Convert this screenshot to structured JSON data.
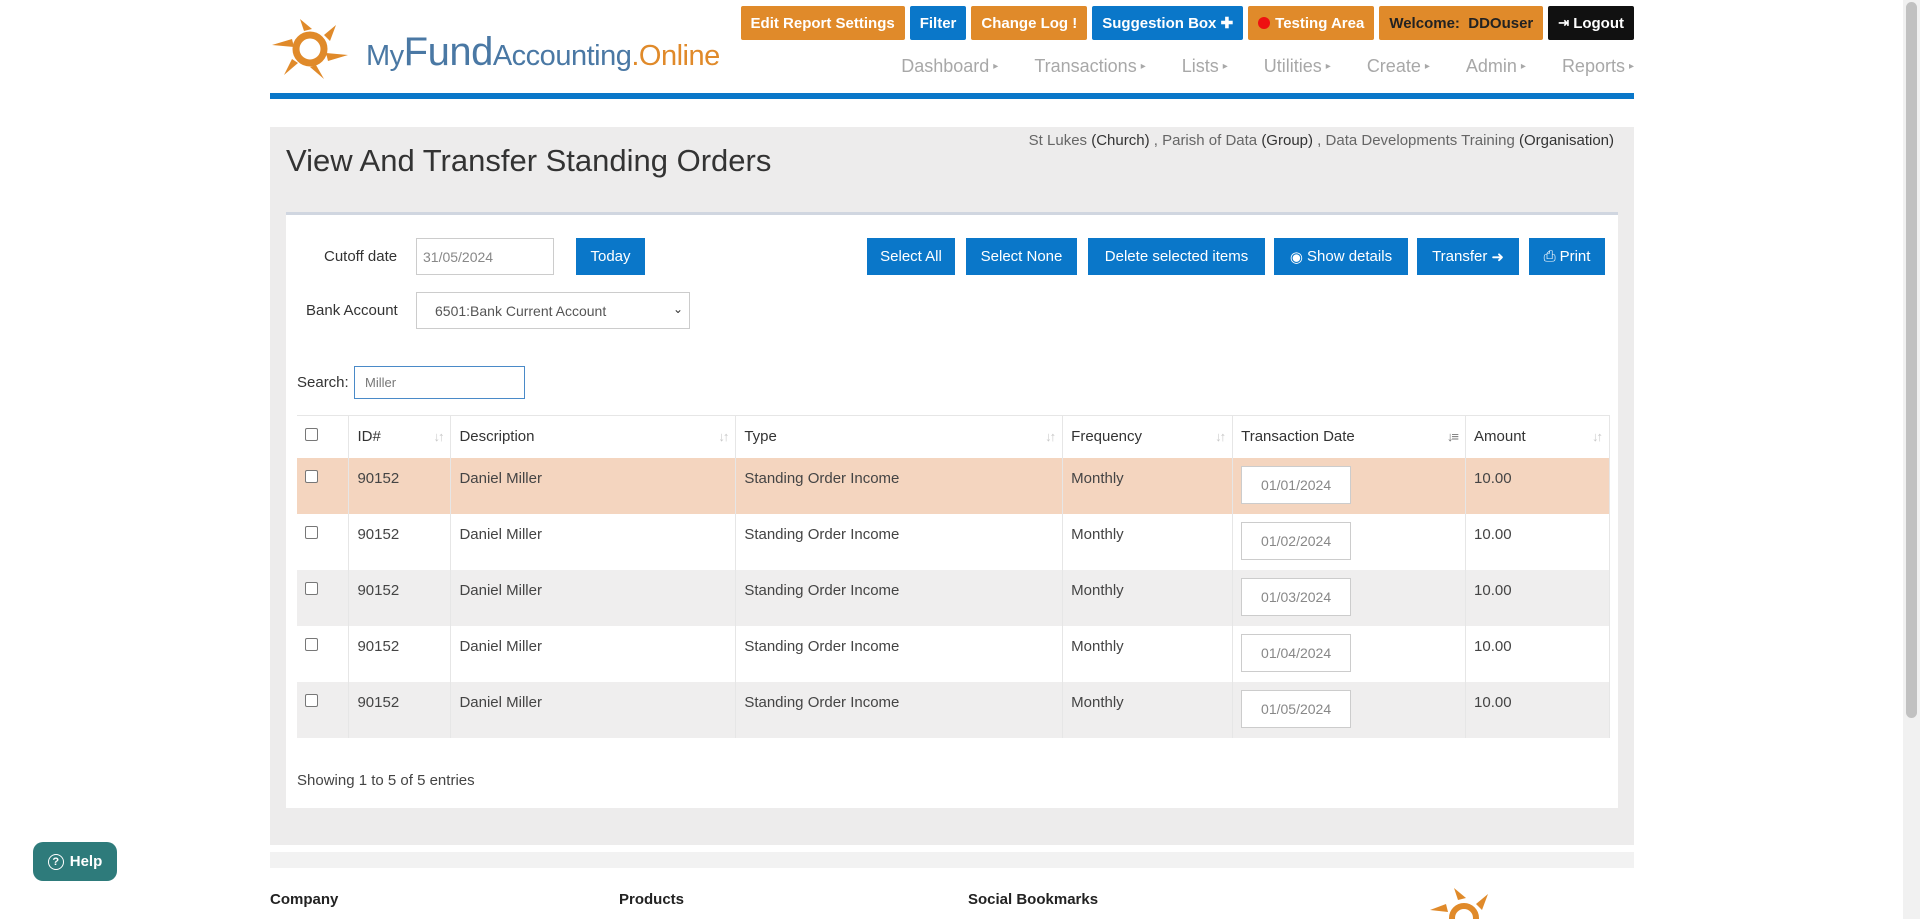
{
  "logo": {
    "my": "My",
    "fund": "Fund",
    "accounting": "Accounting",
    "dot": ".",
    "online": "Online"
  },
  "topbar": {
    "edit_report": "Edit Report Settings",
    "filter": "Filter",
    "changelog": "Change Log !",
    "suggestion": "Suggestion Box ✚",
    "testing": "Testing Area",
    "welcome_prefix": "Welcome:",
    "welcome_user": "DDOuser",
    "logout": "Logout"
  },
  "nav": [
    "Dashboard",
    "Transactions",
    "Lists",
    "Utilities",
    "Create",
    "Admin",
    "Reports"
  ],
  "org": {
    "church": "St Lukes",
    "church_type": "(Church)",
    "group": "Parish of Data",
    "group_type": "(Group)",
    "org": "Data Developments Training",
    "org_type": "(Organisation)"
  },
  "page_title": "View And Transfer Standing Orders",
  "form": {
    "cutoff_label": "Cutoff date",
    "cutoff_value": "31/05/2024",
    "today": "Today",
    "bank_label": "Bank Account",
    "bank_value": "6501:Bank Current Account",
    "search_label": "Search:",
    "search_value": "Miller"
  },
  "actions": {
    "select_all": "Select All",
    "select_none": "Select None",
    "delete_selected": "Delete selected items",
    "show_details": "Show details",
    "transfer": "Transfer",
    "print": "Print"
  },
  "table": {
    "headers": [
      "ID#",
      "Description",
      "Type",
      "Frequency",
      "Transaction Date",
      "Amount"
    ],
    "rows": [
      {
        "id": "90152",
        "desc": "Daniel Miller",
        "type": "Standing Order Income",
        "freq": "Monthly",
        "date": "01/01/2024",
        "amount": "10.00"
      },
      {
        "id": "90152",
        "desc": "Daniel Miller",
        "type": "Standing Order Income",
        "freq": "Monthly",
        "date": "01/02/2024",
        "amount": "10.00"
      },
      {
        "id": "90152",
        "desc": "Daniel Miller",
        "type": "Standing Order Income",
        "freq": "Monthly",
        "date": "01/03/2024",
        "amount": "10.00"
      },
      {
        "id": "90152",
        "desc": "Daniel Miller",
        "type": "Standing Order Income",
        "freq": "Monthly",
        "date": "01/04/2024",
        "amount": "10.00"
      },
      {
        "id": "90152",
        "desc": "Daniel Miller",
        "type": "Standing Order Income",
        "freq": "Monthly",
        "date": "01/05/2024",
        "amount": "10.00"
      }
    ]
  },
  "showing": "Showing 1 to 5 of 5 entries",
  "footer": {
    "company": "Company",
    "products": "Products",
    "social": "Social Bookmarks"
  },
  "help": "Help"
}
